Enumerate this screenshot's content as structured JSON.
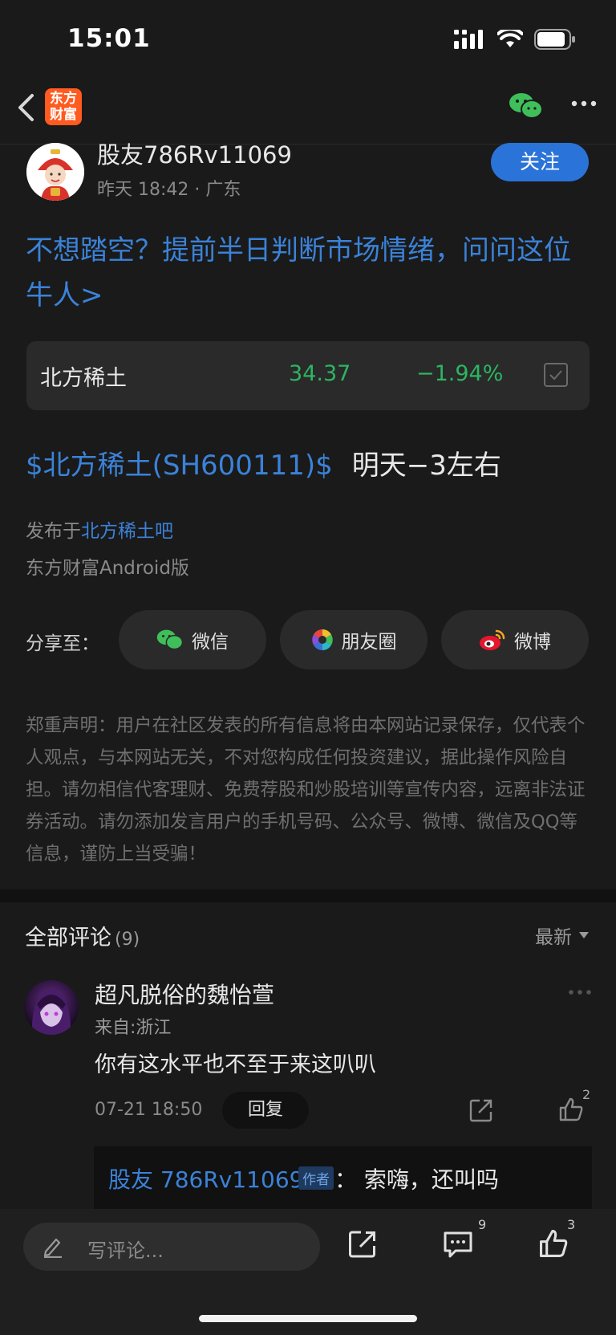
{
  "status_bar": {
    "time": "15:01"
  },
  "nav": {
    "logo_line1": "东方",
    "logo_line2": "财富"
  },
  "post": {
    "author": "股友786Rv11069",
    "time": "昨天 18:42",
    "location": "广东",
    "follow_label": "关注",
    "promo_text": "不想踏空？提前半日判断市场情绪，问问这位牛人>",
    "stock": {
      "name": "北方稀土",
      "price": "34.37",
      "change": "−1.94%"
    },
    "content_stock_tag": "$北方稀土(SH600111)$",
    "content_text": "明天−3左右",
    "published_prefix": "发布于",
    "published_bar": "北方稀土吧",
    "client_source": "东方财富Android版"
  },
  "share": {
    "label": "分享至：",
    "wechat": "微信",
    "moments": "朋友圈",
    "weibo": "微博"
  },
  "disclaimer": "郑重声明：用户在社区发表的所有信息将由本网站记录保存，仅代表个人观点，与本网站无关，不对您构成任何投资建议，据此操作风险自担。请勿相信代客理财、免费荐股和炒股培训等宣传内容，远离非法证券活动。请勿添加发言用户的手机号码、公众号、微博、微信及QQ等信息，谨防上当受骗！",
  "comments": {
    "title": "全部评论",
    "count": "(9)",
    "sort": "最新",
    "items": [
      {
        "author": "超凡脱俗的魏怡萱",
        "location": "来自:浙江",
        "text": "你有这水平也不至于来这叭叭",
        "time": "07-21 18:50",
        "reply_label": "回复",
        "likes": "2",
        "reply": {
          "author": "股友 786Rv11069",
          "badge": "作者",
          "text": "：  索嗨，还叫吗"
        }
      }
    ]
  },
  "bottom_bar": {
    "input_placeholder": "写评论...",
    "comment_count": "9",
    "like_count": "3"
  },
  "colors": {
    "accent_blue": "#2a73d9",
    "link_blue": "#3b82d8",
    "down_green": "#2db561",
    "background": "#1a1a1a"
  }
}
